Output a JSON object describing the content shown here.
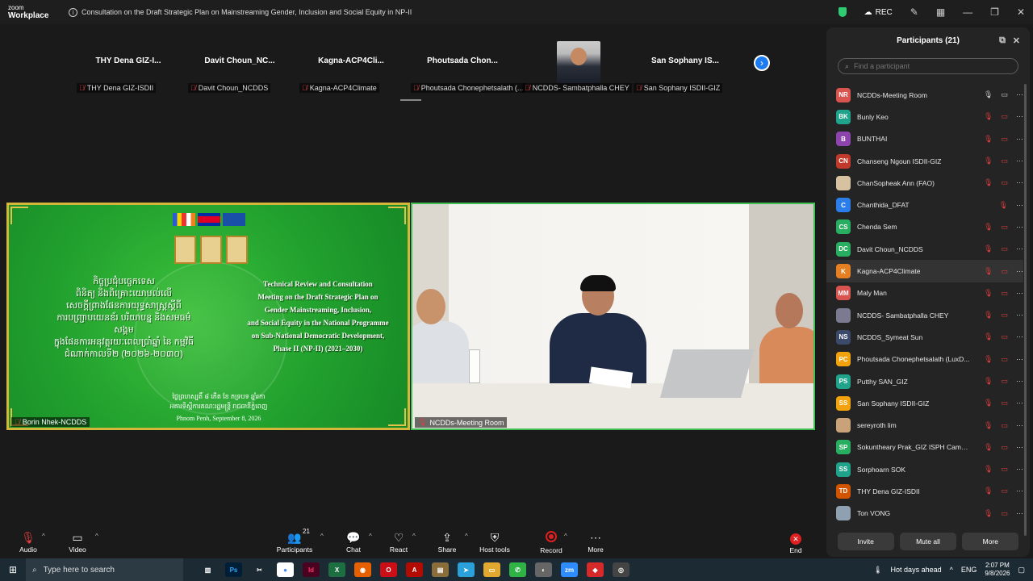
{
  "window": {
    "logo_line1": "zoom",
    "logo_line2": "Workplace",
    "meeting_title": "Consultation on the Draft Strategic Plan on Mainstreaming Gender, Inclusion and Social Equity in NP-II",
    "rec_label": "REC"
  },
  "strip": {
    "tiles": [
      {
        "name": "THY Dena GIZ-I...",
        "tag": "THY Dena GIZ-ISDII"
      },
      {
        "name": "Davit  Choun_NC...",
        "tag": "Davit Choun_NCDDS"
      },
      {
        "name": "Kagna-ACP4Cli...",
        "tag": "Kagna-ACP4Climate"
      },
      {
        "name": "Phoutsada  Chon...",
        "tag": "Phoutsada Chonephetsalath (..."
      },
      {
        "name": "",
        "tag": "NCDDS- Sambatphalla CHEY"
      },
      {
        "name": "San Sophany  IS...",
        "tag": "San Sophany ISDII-GIZ"
      }
    ]
  },
  "share": {
    "khmer_lines": [
      "កិច្ចប្រជុំបច្ចេកទេស",
      "ពិនិត្យ និងពិគ្រោះយោបល់លើ",
      "សេចក្តីព្រាងផែនការយុទ្ធសាស្ត្រស្តីពី",
      "ការបញ្ជ្រាបយេនឌ័រ បរិយាបន្ន និងសមធម៌សង្គម",
      "ក្នុងផែនការអនុវត្តរយៈពេលប្រាំឆ្នាំ នៃ កម្មវិធី",
      "ជំណាក់កាលទី២ (២០២៦-២០៣០)"
    ],
    "khmer_small": [
      "ថ្ងៃ​ព្រហស្បតិ៍ ៨ កើត ខែ ភទ្របទ ឆ្នាំរកា",
      "អគារទីស្តីការគណៈរដ្ឋមន្ត្រី រាជធានីភ្នំពេញ"
    ],
    "english_lines": [
      "Technical Review and Consultation",
      "Meeting on the Draft Strategic Plan on",
      "Gender Mainstreaming, Inclusion,",
      "and Social Equity in the National Programme",
      "on Sub-National Democratic Development,",
      "Phase II (NP-II) (2021–2030)"
    ],
    "location": "Phnom Penh, September 8, 2026",
    "tag": "Borin Nhek-NCDDS"
  },
  "video": {
    "tag": "NCDDs-Meeting Room"
  },
  "participants": {
    "title": "Participants (21)",
    "search_placeholder": "Find a participant",
    "list": [
      {
        "initials": "NR",
        "name": "NCDDs-Meeting Room",
        "color": "#d9534f",
        "state": "on"
      },
      {
        "initials": "BK",
        "name": "Bunly Keo",
        "color": "#1fa38a",
        "state": "off"
      },
      {
        "initials": "B",
        "name": "BUNTHAI",
        "color": "#8e44ad",
        "state": "off"
      },
      {
        "initials": "CN",
        "name": "Chanseng Ngoun ISDII-GIZ",
        "color": "#c0392b",
        "state": "off"
      },
      {
        "initials": "",
        "name": "ChanSopheak Ann (FAO)",
        "color": "#d6c2a0",
        "state": "off"
      },
      {
        "initials": "C",
        "name": "Chanthida_DFAT",
        "color": "#2b7de9",
        "state": "mic"
      },
      {
        "initials": "CS",
        "name": "Chenda Sem",
        "color": "#27ae60",
        "state": "off"
      },
      {
        "initials": "DC",
        "name": "Davit Choun_NCDDS",
        "color": "#27ae60",
        "state": "off"
      },
      {
        "initials": "K",
        "name": "Kagna-ACP4Climate",
        "color": "#e67e22",
        "state": "hover"
      },
      {
        "initials": "MM",
        "name": "Maly Man",
        "color": "#d9534f",
        "state": "off"
      },
      {
        "initials": "",
        "name": "NCDDS- Sambatphalla CHEY",
        "color": "#7a7a90",
        "state": "off"
      },
      {
        "initials": "NS",
        "name": "NCDDS_Symeat Sun",
        "color": "#3b4a6b",
        "state": "off"
      },
      {
        "initials": "PC",
        "name": "Phoutsada Chonephetsalath (LuxD...",
        "color": "#f1a20c",
        "state": "off"
      },
      {
        "initials": "PS",
        "name": "Putthy SAN_GIZ",
        "color": "#1fa38a",
        "state": "off"
      },
      {
        "initials": "SS",
        "name": "San Sophany ISDII-GIZ",
        "color": "#f1a20c",
        "state": "off"
      },
      {
        "initials": "",
        "name": "sereyroth lim",
        "color": "#caa27a",
        "state": "off"
      },
      {
        "initials": "SP",
        "name": "Sokuntheary Prak_GIZ ISPH Cambo...",
        "color": "#27ae60",
        "state": "off"
      },
      {
        "initials": "SS",
        "name": "Sorphoarn SOK",
        "color": "#1fa38a",
        "state": "off"
      },
      {
        "initials": "TD",
        "name": "THY Dena GIZ-ISDII",
        "color": "#d35400",
        "state": "off"
      },
      {
        "initials": "",
        "name": "Ton VONG",
        "color": "#8fa0b0",
        "state": "off"
      }
    ],
    "invite": "Invite",
    "mute_all": "Mute all",
    "more": "More"
  },
  "toolbar": {
    "audio": "Audio",
    "video": "Video",
    "participants": "Participants",
    "participants_count": "21",
    "chat": "Chat",
    "react": "React",
    "share": "Share",
    "host_tools": "Host tools",
    "record": "Record",
    "more": "More",
    "end": "End"
  },
  "taskbar": {
    "search_placeholder": "Type here to search",
    "weather": "Hot days ahead",
    "lang": "ENG",
    "time": "2:07 PM",
    "date": "9/8/2026"
  }
}
